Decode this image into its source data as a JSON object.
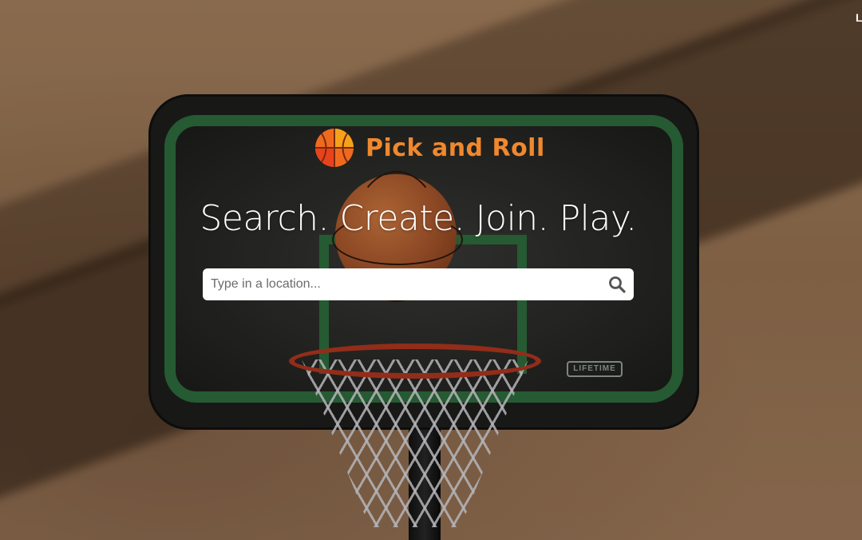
{
  "brand": {
    "name": "Pick and Roll",
    "logo_icon": "basketball-icon",
    "color": "#f0882e"
  },
  "hero": {
    "tagline": "Search. Create. Join. Play."
  },
  "search": {
    "placeholder": "Type in a location...",
    "value": "",
    "icon": "search-icon"
  },
  "nav": {
    "corner_link": "L"
  },
  "background": {
    "backboard_badge": "LIFETIME"
  }
}
